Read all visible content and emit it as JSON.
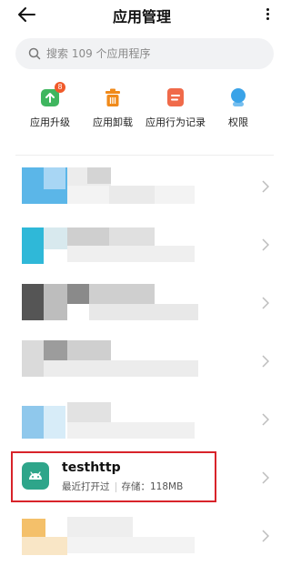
{
  "header": {
    "title": "应用管理"
  },
  "search": {
    "placeholder": "搜索 109 个应用程序"
  },
  "quick_actions": [
    {
      "label": "应用升级",
      "icon": "upgrade-icon",
      "badge": "8",
      "color": "#3fb65f"
    },
    {
      "label": "应用卸载",
      "icon": "trash-icon",
      "color": "#f08a1a"
    },
    {
      "label": "应用行为记录",
      "icon": "record-icon",
      "color": "#f06a4a"
    },
    {
      "label": "权限",
      "icon": "permission-icon",
      "color": "#3aa3e8"
    }
  ],
  "selected_app": {
    "name": "testhttp",
    "status": "最近打开过",
    "storage": "存储：118MB"
  },
  "colors": {
    "highlight": "#d8232a",
    "accent": "#2ea58a"
  }
}
